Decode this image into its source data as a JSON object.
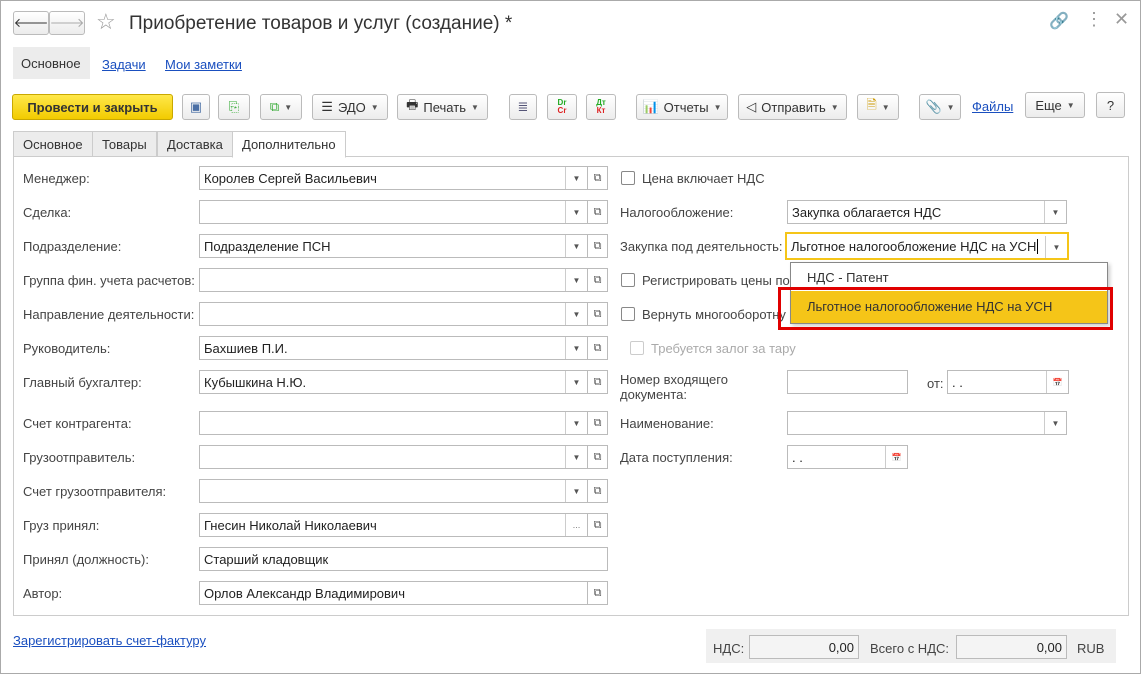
{
  "title": "Приобретение товаров и услуг (создание) *",
  "nav_tabs": [
    "Основное",
    "Задачи",
    "Мои заметки"
  ],
  "toolbar": {
    "post_close": "Провести и закрыть",
    "edo": "ЭДО",
    "print": "Печать",
    "dtkt_dr": "Dr",
    "dtkt_cr": "Cr",
    "dt": "Дт",
    "kt": "Кт",
    "reports": "Отчеты",
    "send": "Отправить",
    "files": "Файлы",
    "more": "Еще",
    "help": "?"
  },
  "form_tabs": [
    "Основное",
    "Товары",
    "Доставка",
    "Дополнительно"
  ],
  "left_fields": [
    {
      "label": "Менеджер:",
      "value": "Королев Сергей Васильевич"
    },
    {
      "label": "Сделка:",
      "value": ""
    },
    {
      "label": "Подразделение:",
      "value": "Подразделение ПСН"
    },
    {
      "label": "Группа фин. учета расчетов:",
      "value": ""
    },
    {
      "label": "Направление деятельности:",
      "value": ""
    },
    {
      "label": "Руководитель:",
      "value": "Бахшиев П.И."
    },
    {
      "label": "Главный бухгалтер:",
      "value": "Кубышкина Н.Ю."
    },
    {
      "label": "Счет контрагента:",
      "value": ""
    },
    {
      "label": "Грузоотправитель:",
      "value": ""
    },
    {
      "label": "Счет грузоотправителя:",
      "value": ""
    },
    {
      "label": "Груз принял:",
      "value": "Гнесин Николай Николаевич"
    },
    {
      "label": "Принял (должность):",
      "value": "Старший кладовщик"
    },
    {
      "label": "Автор:",
      "value": "Орлов Александр Владимирович"
    }
  ],
  "right": {
    "price_incl_vat": "Цена включает НДС",
    "taxation_label": "Налогообложение:",
    "taxation_value": "Закупка облагается НДС",
    "activity_label": "Закупка под деятельность:",
    "activity_value": "Льготное налогообложение НДС на УСН",
    "register_prices": "Регистрировать цены по",
    "return_reusable": "Вернуть многооборотну",
    "deposit": "Требуется залог за тару",
    "in_doc_label": "Номер входящего документа:",
    "in_doc_value": "",
    "from_label": "от:",
    "from_value": " .  .",
    "name_label": "Наименование:",
    "name_value": "",
    "receipt_label": "Дата поступления:",
    "receipt_value": " .  ."
  },
  "dropdown": {
    "options": [
      "НДС - Патент",
      "Льготное налогообложение НДС на УСН"
    ],
    "selected": 1,
    "highlight_color": "#f5c518",
    "annotation_color": "#e00000"
  },
  "footer": {
    "invoice_link": "Зарегистрировать счет-фактуру",
    "vat_label": "НДС:",
    "vat_value": "0,00",
    "total_label": "Всего с НДС:",
    "total_value": "0,00",
    "currency": "RUB"
  }
}
